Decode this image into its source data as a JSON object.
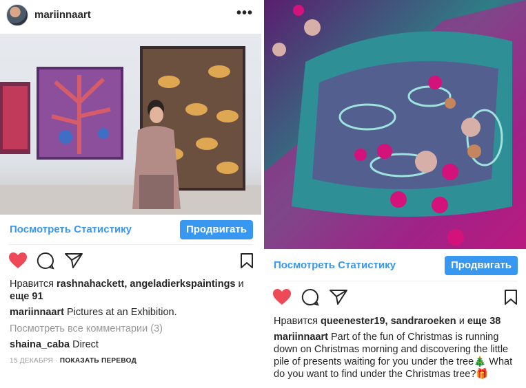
{
  "left_post": {
    "username": "mariinnaart",
    "more": "•••",
    "stats_link": "Посмотреть Статистику",
    "promote_button": "Продвигать",
    "likes_prefix": "Нравится",
    "likes_users": "rashnahackett, angeladierkspaintings",
    "likes_joiner": "и",
    "likes_more": "еще 91",
    "caption_user": "mariinnaart",
    "caption_text": "Pictures at an Exhibition.",
    "view_comments": "Посмотреть все комментарии (3)",
    "comment_user": "shaina_caba",
    "comment_text": "Direct",
    "date": "15 ДЕКАБРЯ",
    "translate": "ПОКАЗАТЬ ПЕРЕВОД"
  },
  "right_post": {
    "stats_link": "Посмотреть Статистику",
    "promote_button": "Продвигать",
    "likes_prefix": "Нравится",
    "likes_users": "queenester19, sandraroeken",
    "likes_joiner": "и",
    "likes_more": "еще 38",
    "caption_user": "mariinnaart",
    "caption_text": "Part of the fun of Christmas is running down on Christmas morning and discovering the little pile of presents waiting for you under the tree🎄 What do you want to find under the Christmas tree?🎁"
  },
  "icons": [
    "heart-filled-icon",
    "comment-icon",
    "direct-share-icon",
    "bookmark-icon",
    "more-icon"
  ],
  "colors": {
    "accent": "#3897f0",
    "like": "#ed4956",
    "text": "#262626",
    "muted": "#999999"
  }
}
